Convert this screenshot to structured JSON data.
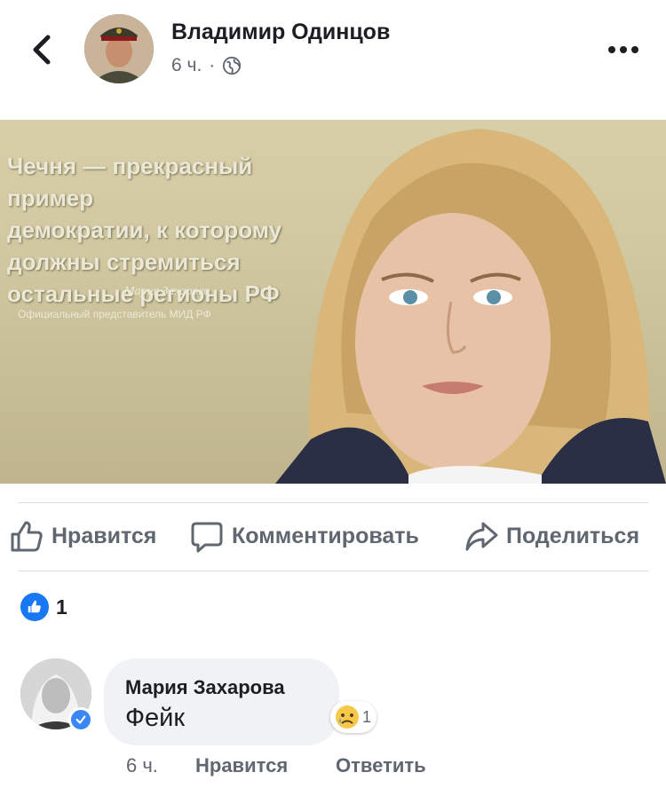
{
  "header": {
    "author": "Владимир Одинцов",
    "time": "6 ч.",
    "separator": "·"
  },
  "photo": {
    "overlay_lines": [
      "Чечня — прекрасный пример",
      "демократии, к которому",
      "должны стремиться",
      "остальные регионы РФ"
    ],
    "signature": "Мария Захарова",
    "role": "Официальный представитель МИД РФ"
  },
  "actions": {
    "like": "Нравится",
    "comment": "Комментировать",
    "share": "Поделиться"
  },
  "reactions": {
    "count": "1"
  },
  "comment": {
    "author": "Мария Захарова",
    "text": "Фейк",
    "reaction_count": "1",
    "time": "6 ч.",
    "like": "Нравится",
    "reply": "Ответить"
  },
  "colors": {
    "accent": "#1877f2",
    "muted_text": "#606770",
    "bubble": "#f0f2f5"
  },
  "icons": {
    "back": "chevron-left-icon",
    "more": "more-dots-icon",
    "privacy": "globe-icon",
    "like": "thumbs-up-icon",
    "comment": "comment-bubble-icon",
    "share": "share-arrow-icon",
    "reaction": "like-reaction-icon",
    "comment_reaction": "sad-face-icon",
    "verified": "verified-check-icon"
  }
}
